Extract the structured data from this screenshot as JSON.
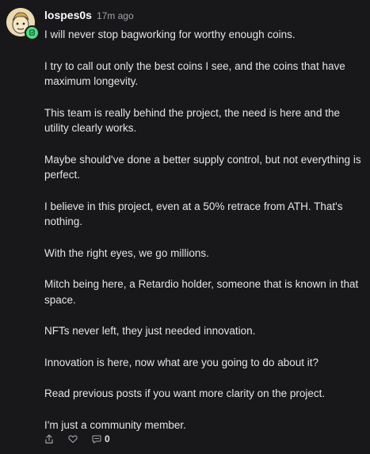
{
  "comment": {
    "username": "lospes0s",
    "timestamp": "17m ago",
    "paragraphs": [
      "I will never stop bagworking for worthy enough coins.",
      "I try to call out only the best coins I see, and the coins that have maximum longevity.",
      "This team is really behind the project, the need is here and the utility clearly works.",
      "Maybe should've done a better supply control, but not everything is perfect.",
      "I believe in this project, even at a 50% retrace from ATH. That's nothing.",
      "With the right eyes, we go millions.",
      "Mitch being here, a Retardio holder, someone that is known in that space.",
      "NFTs never left, they just needed innovation.",
      "Innovation is here, now what are you going to do about it?",
      "Read previous posts if you want more clarity on the project.",
      "I'm just a community member."
    ],
    "reply_count": "0"
  },
  "icons": {
    "avatar_badge": "verified-badge-icon",
    "share": "share-icon",
    "like": "heart-icon",
    "reply": "chat-bubble-icon"
  },
  "colors": {
    "background": "#18181b",
    "text": "#e4e4e7",
    "muted": "#a1a1aa",
    "badge": "#4ade80"
  }
}
